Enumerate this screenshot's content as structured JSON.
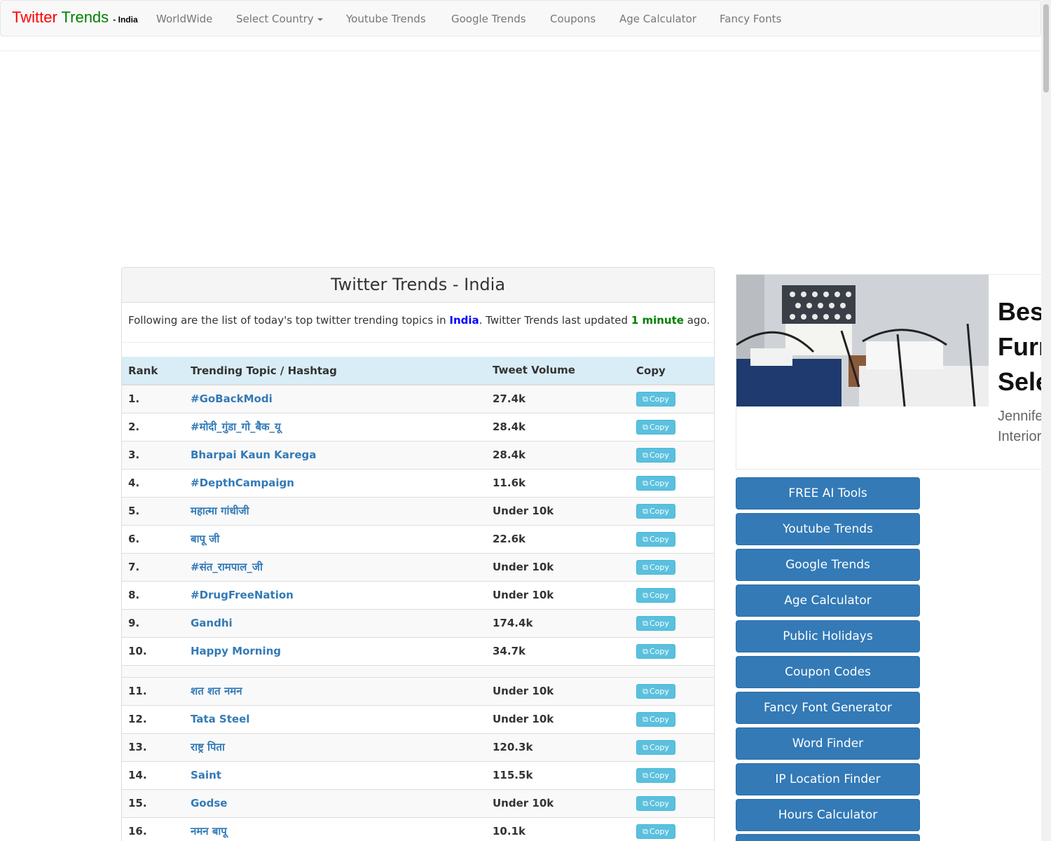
{
  "navbar": {
    "brand": {
      "part1": "Twitter",
      "part2": "Trends",
      "part3": "- India"
    },
    "items": [
      "WorldWide",
      "Select Country",
      "Youtube Trends",
      "Google Trends",
      "Coupons",
      "Age Calculator",
      "Fancy Fonts"
    ]
  },
  "panel": {
    "title": "Twitter Trends - India",
    "intro_prefix": "Following are the list of today's top twitter trending topics in ",
    "intro_country": "India",
    "intro_middle": ". Twitter Trends last updated ",
    "intro_time": "1 minute",
    "intro_suffix": " ago."
  },
  "table": {
    "headers": {
      "rank": "Rank",
      "topic": "Trending Topic / Hashtag",
      "volume": "Tweet Volume",
      "copy": "Copy"
    },
    "copy_label": "Copy",
    "rows": [
      {
        "rank": "1.",
        "topic": "#GoBackModi",
        "volume": "27.4k"
      },
      {
        "rank": "2.",
        "topic": "#मोदी_गुंडा_गो_बैक_यू",
        "volume": "28.4k"
      },
      {
        "rank": "3.",
        "topic": "Bharpai Kaun Karega",
        "volume": "28.4k"
      },
      {
        "rank": "4.",
        "topic": "#DepthCampaign",
        "volume": "11.6k"
      },
      {
        "rank": "5.",
        "topic": "महात्मा गांधीजी",
        "volume": "Under 10k"
      },
      {
        "rank": "6.",
        "topic": "बापू जी",
        "volume": "22.6k"
      },
      {
        "rank": "7.",
        "topic": "#संत_रामपाल_जी",
        "volume": "Under 10k"
      },
      {
        "rank": "8.",
        "topic": "#DrugFreeNation",
        "volume": "Under 10k"
      },
      {
        "rank": "9.",
        "topic": "Gandhi",
        "volume": "174.4k"
      },
      {
        "rank": "10.",
        "topic": "Happy Morning",
        "volume": "34.7k"
      },
      {
        "rank": "11.",
        "topic": "शत शत नमन",
        "volume": "Under 10k"
      },
      {
        "rank": "12.",
        "topic": "Tata Steel",
        "volume": "Under 10k"
      },
      {
        "rank": "13.",
        "topic": "राष्ट्र पिता",
        "volume": "120.3k"
      },
      {
        "rank": "14.",
        "topic": "Saint",
        "volume": "115.5k"
      },
      {
        "rank": "15.",
        "topic": "Godse",
        "volume": "Under 10k"
      },
      {
        "rank": "16.",
        "topic": "नमन बापू",
        "volume": "10.1k"
      }
    ]
  },
  "ad": {
    "title": "Best Furniture Selection",
    "subtitle": "Jennifer Interiors"
  },
  "sidebar_buttons": [
    "FREE AI Tools",
    "Youtube Trends",
    "Google Trends",
    "Age Calculator",
    "Public Holidays",
    "Coupon Codes",
    "Fancy Font Generator",
    "Word Finder",
    "IP Location Finder",
    "Hours Calculator"
  ],
  "colors": {
    "link": "#337ab7",
    "copy_button": "#5bc0de",
    "table_header": "#d9edf7",
    "brand_red": "#ff0000",
    "brand_green": "#008000"
  }
}
